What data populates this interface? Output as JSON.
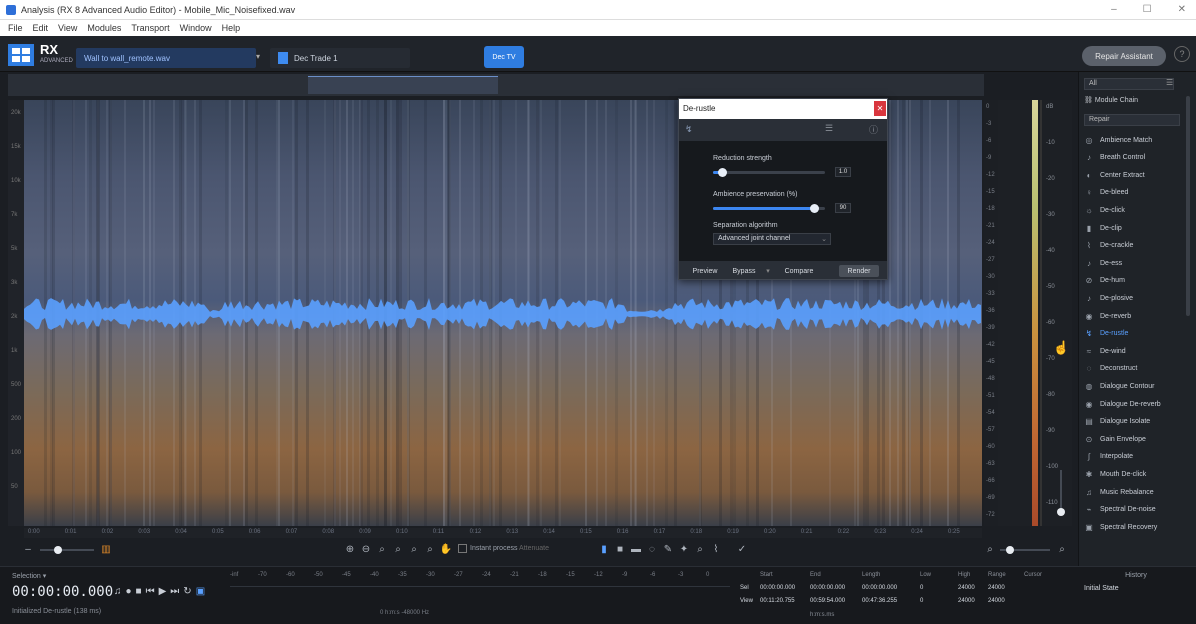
{
  "window": {
    "title": "Analysis (RX 8 Advanced Audio Editor) - Mobile_Mic_Noisefixed.wav",
    "controls": [
      "–",
      "☐",
      "✕"
    ]
  },
  "menu": [
    "File",
    "Edit",
    "View",
    "Modules",
    "Transport",
    "Window",
    "Help"
  ],
  "toolbar": {
    "logo": "RX",
    "edition": "ADVANCED",
    "file_tab": "Wall to wall_remote.wav",
    "clip_tab": "Dec Trade 1",
    "active_tab": "Dec TV",
    "repair_button": "Repair Assistant",
    "help": "?"
  },
  "spectrogram": {
    "freq_labels": [
      "20k",
      "15k",
      "10k",
      "7k",
      "5k",
      "3k",
      "2k",
      "1k",
      "500",
      "200",
      "100",
      "50"
    ],
    "time_labels": [
      "0:00",
      "0:01",
      "0:02",
      "0:03",
      "0:04",
      "0:05",
      "0:06",
      "0:07",
      "0:08",
      "0:09",
      "0:10",
      "0:11",
      "0:12",
      "0:13",
      "0:14",
      "0:15",
      "0:16",
      "0:17",
      "0:18",
      "0:19",
      "0:20",
      "0:21",
      "0:22",
      "0:23",
      "0:24",
      "0:25"
    ]
  },
  "dialog": {
    "title": "De-rustle",
    "close": "✕",
    "reduction_label": "Reduction strength",
    "reduction_value": "1.0",
    "reduction_fraction": 0.08,
    "ambience_label": "Ambience preservation (%)",
    "ambience_value": "90",
    "ambience_fraction": 0.9,
    "algorithm_label": "Separation algorithm",
    "algorithm_value": "Advanced joint channel",
    "preview": "Preview",
    "bypass": "Bypass",
    "compare": "Compare",
    "render": "Render"
  },
  "meters": {
    "scale": [
      "0",
      "-3",
      "-6",
      "-9",
      "-12",
      "-15",
      "-18",
      "-21",
      "-24",
      "-27",
      "-30",
      "-33",
      "-36",
      "-39",
      "-42",
      "-45",
      "-48",
      "-51",
      "-54",
      "-57",
      "-60",
      "-63",
      "-66",
      "-69",
      "-72"
    ],
    "right_labels": [
      "dB",
      "-10",
      "-20",
      "-30",
      "-40",
      "-50",
      "-60",
      "-70",
      "-80",
      "-90",
      "-100",
      "-110"
    ]
  },
  "panel": {
    "filter": "All",
    "chain": "Module Chain",
    "group": "Repair",
    "modules": [
      {
        "icon": "◎",
        "label": "Ambience Match"
      },
      {
        "icon": "♪",
        "label": "Breath Control"
      },
      {
        "icon": "◐",
        "label": "Center Extract"
      },
      {
        "icon": "♀",
        "label": "De-bleed"
      },
      {
        "icon": "☼",
        "label": "De-click"
      },
      {
        "icon": "▮",
        "label": "De-clip"
      },
      {
        "icon": "⌇",
        "label": "De-crackle"
      },
      {
        "icon": "♪",
        "label": "De-ess"
      },
      {
        "icon": "⊘",
        "label": "De-hum"
      },
      {
        "icon": "♪",
        "label": "De-plosive"
      },
      {
        "icon": "◉",
        "label": "De-reverb"
      },
      {
        "icon": "↯",
        "label": "De-rustle"
      },
      {
        "icon": "≈",
        "label": "De-wind"
      },
      {
        "icon": "◌",
        "label": "Deconstruct"
      },
      {
        "icon": "◍",
        "label": "Dialogue Contour"
      },
      {
        "icon": "◉",
        "label": "Dialogue De-reverb"
      },
      {
        "icon": "▤",
        "label": "Dialogue Isolate"
      },
      {
        "icon": "⊙",
        "label": "Gain Envelope"
      },
      {
        "icon": "∫",
        "label": "Interpolate"
      },
      {
        "icon": "✱",
        "label": "Mouth De-click"
      },
      {
        "icon": "♫",
        "label": "Music Rebalance"
      },
      {
        "icon": "⌁",
        "label": "Spectral De-noise"
      },
      {
        "icon": "▣",
        "label": "Spectral Recovery"
      }
    ],
    "active_index": 11
  },
  "controls": {
    "instant_process": "Instant process",
    "mode": "Attenuate"
  },
  "transport": {
    "rec_label": "Selection ▾",
    "timecode": "00:00:00.000",
    "status": "Initialized De-rustle (138 ms)",
    "ruler": [
      "-inf",
      "-70",
      "-60",
      "-50",
      "-45",
      "-40",
      "-35",
      "-30",
      "-27",
      "-24",
      "-21",
      "-18",
      "-15",
      "-12",
      "-9",
      "-6",
      "-3",
      "0"
    ],
    "bottom": "0 h:m:s  -48000 Hz"
  },
  "info": {
    "headers": [
      "Start",
      "End",
      "Length",
      "Low",
      "High",
      "Range",
      "Cursor"
    ],
    "sel_label": "Sel",
    "view_label": "View",
    "sel": [
      "00:00:00.000",
      "00:00:00.000",
      "00:00:00.000",
      "0",
      "24000",
      "24000"
    ],
    "view": [
      "00:11:20.755",
      "00:59:54.000",
      "00:47:36.255",
      "0",
      "24000",
      "24000"
    ],
    "footer": "h:m:s.ms"
  },
  "history": {
    "title": "History",
    "item": "Initial State"
  },
  "colors": {
    "accent": "#2f7de1",
    "waveform": "#5aa0ff",
    "close": "#d9363e"
  }
}
